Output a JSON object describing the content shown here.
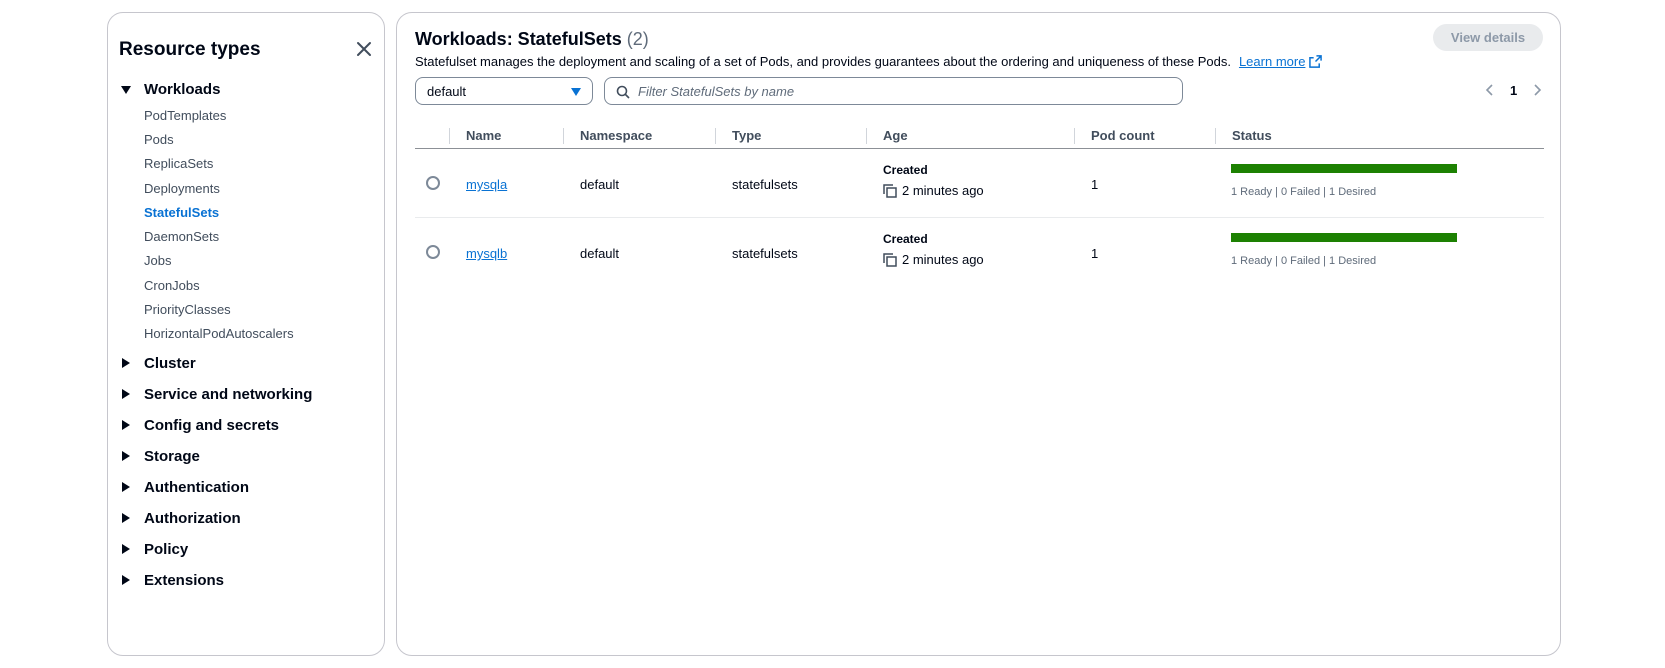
{
  "sidebar": {
    "title": "Resource types",
    "groups": [
      {
        "label": "Workloads",
        "expanded": true,
        "items": [
          {
            "label": "PodTemplates"
          },
          {
            "label": "Pods"
          },
          {
            "label": "ReplicaSets"
          },
          {
            "label": "Deployments"
          },
          {
            "label": "StatefulSets",
            "active": true
          },
          {
            "label": "DaemonSets"
          },
          {
            "label": "Jobs"
          },
          {
            "label": "CronJobs"
          },
          {
            "label": "PriorityClasses"
          },
          {
            "label": "HorizontalPodAutoscalers"
          }
        ]
      },
      {
        "label": "Cluster",
        "expanded": false
      },
      {
        "label": "Service and networking",
        "expanded": false
      },
      {
        "label": "Config and secrets",
        "expanded": false
      },
      {
        "label": "Storage",
        "expanded": false
      },
      {
        "label": "Authentication",
        "expanded": false
      },
      {
        "label": "Authorization",
        "expanded": false
      },
      {
        "label": "Policy",
        "expanded": false
      },
      {
        "label": "Extensions",
        "expanded": false
      }
    ]
  },
  "main": {
    "title": "Workloads: StatefulSets",
    "count": "(2)",
    "view_details": "View details",
    "description": "Statefulset manages the deployment and scaling of a set of Pods, and provides guarantees about the ordering and uniqueness of these Pods.",
    "learn_more": "Learn more",
    "namespace_value": "default",
    "filter_placeholder": "Filter StatefulSets by name",
    "page_number": "1",
    "columns": [
      "Name",
      "Namespace",
      "Type",
      "Age",
      "Pod count",
      "Status"
    ],
    "rows": [
      {
        "name": "mysqla",
        "namespace": "default",
        "type": "statefulsets",
        "age_label": "Created",
        "age": "2 minutes ago",
        "pod_count": "1",
        "status_ready_fraction": 1.0,
        "status_text": "1 Ready | 0 Failed | 1 Desired"
      },
      {
        "name": "mysqlb",
        "namespace": "default",
        "type": "statefulsets",
        "age_label": "Created",
        "age": "2 minutes ago",
        "pod_count": "1",
        "status_ready_fraction": 1.0,
        "status_text": "1 Ready | 0 Failed | 1 Desired"
      }
    ]
  },
  "colors": {
    "accent": "#0972d3",
    "success": "#1d8102"
  }
}
